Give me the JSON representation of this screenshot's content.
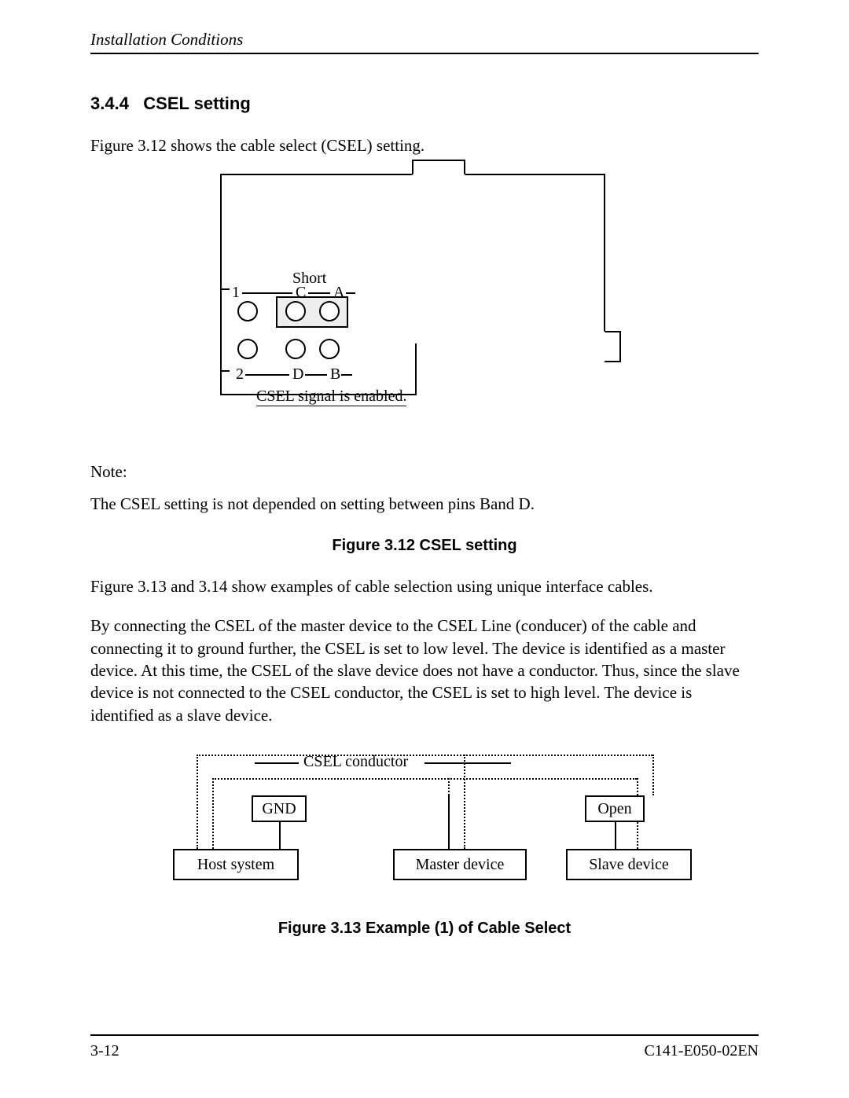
{
  "header": {
    "running_title": "Installation Conditions"
  },
  "section": {
    "number": "3.4.4",
    "title": "CSEL setting",
    "intro": "Figure 3.12 shows the cable select (CSEL) setting."
  },
  "figure312": {
    "short_label": "Short",
    "pin_1": "1",
    "pin_2": "2",
    "pin_A": "A",
    "pin_B": "B",
    "pin_C": "C",
    "pin_D": "D",
    "csel_enabled": "CSEL signal is enabled.",
    "caption": "Figure 3.12  CSEL setting"
  },
  "note": {
    "label": "Note:",
    "text": "The CSEL setting is not depended on setting between pins Band D."
  },
  "after_fig312": {
    "para1": "Figure 3.13 and 3.14 show examples of cable selection using unique interface cables.",
    "para2": "By connecting the CSEL of the master device to the CSEL Line (conducer) of the cable and connecting it to ground further, the CSEL is set to low level.  The device is identified as a master device.  At this time, the CSEL of the slave device does not have a conductor.  Thus, since the slave device is not connected to the CSEL conductor, the CSEL is set to high level.  The device is identified as a slave device."
  },
  "figure313": {
    "csel_conductor": "CSEL conductor",
    "gnd": "GND",
    "open": "Open",
    "host": "Host system",
    "master": "Master device",
    "slave": "Slave device",
    "caption": "Figure 3.13  Example (1) of Cable Select"
  },
  "footer": {
    "page": "3-12",
    "doc": "C141-E050-02EN"
  }
}
